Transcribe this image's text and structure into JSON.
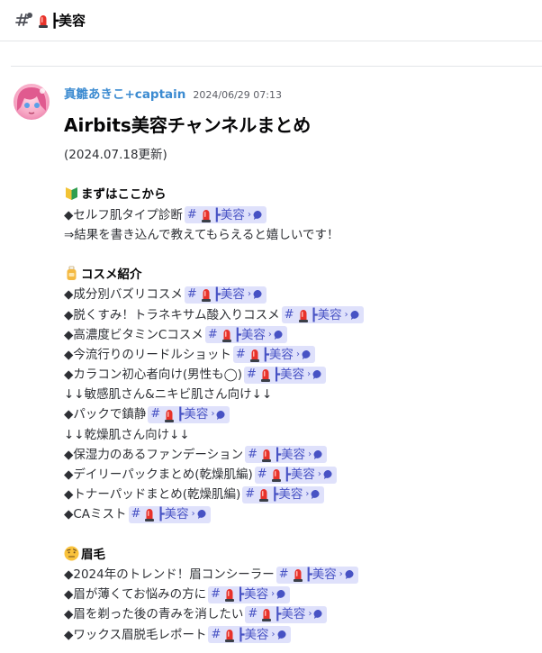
{
  "channel": {
    "name": "┣美容"
  },
  "message": {
    "author": "真雛あきこ+captain",
    "timestamp": "2024/06/29 07:13",
    "title": "Airbits美容チャンネルまとめ",
    "updated": "(2024.07.18更新)",
    "sections": [
      {
        "icon": "beginner-leaf-icon",
        "heading": "まずはここから",
        "lines": [
          {
            "text": "◆セルフ肌タイプ診断",
            "chip": "┣美容"
          },
          {
            "text": "⇒結果を書き込んで教えてもらえると嬉しいです！"
          }
        ]
      },
      {
        "icon": "lotion-bottle-icon",
        "heading": "コスメ紹介",
        "lines": [
          {
            "text": "◆成分別バズリコスメ",
            "chip": "┣美容"
          },
          {
            "text": "◆脱くすみ！トラネキサム酸入りコスメ",
            "chip": "┣美容"
          },
          {
            "text": "◆高濃度ビタミンCコスメ",
            "chip": "┣美容"
          },
          {
            "text": "◆今流行りのリードルショット",
            "chip": "┣美容"
          },
          {
            "text": "◆カラコン初心者向け(男性も◯)",
            "chip": "┣美容"
          },
          {
            "text": "↓↓敏感肌さん&ニキビ肌さん向け↓↓"
          },
          {
            "text": "◆パックで鎮静",
            "chip": "┣美容"
          },
          {
            "text": "↓↓乾燥肌さん向け↓↓"
          },
          {
            "text": "◆保湿力のあるファンデーション",
            "chip": "┣美容"
          },
          {
            "text": "◆デイリーパックまとめ(乾燥肌編)",
            "chip": "┣美容"
          },
          {
            "text": "◆トナーパッドまとめ(乾燥肌編)",
            "chip": "┣美容"
          },
          {
            "text": "◆CAミスト",
            "chip": "┣美容"
          }
        ]
      },
      {
        "icon": "raised-eyebrow-face-icon",
        "heading": "眉毛",
        "lines": [
          {
            "text": "◆2024年のトレンド！眉コンシーラー",
            "chip": "┣美容"
          },
          {
            "text": "◆眉が薄くてお悩みの方に",
            "chip": "┣美容"
          },
          {
            "text": "◆眉を剃った後の青みを消したい",
            "chip": "┣美容"
          },
          {
            "text": "◆ワックス眉脱毛レポート",
            "chip": "┣美容"
          }
        ]
      }
    ]
  },
  "colors": {
    "author": "#3c8bd1",
    "chip_bg": "#dfe1fb",
    "chip_text": "#4752c4",
    "siren_red": "#e8322a"
  }
}
